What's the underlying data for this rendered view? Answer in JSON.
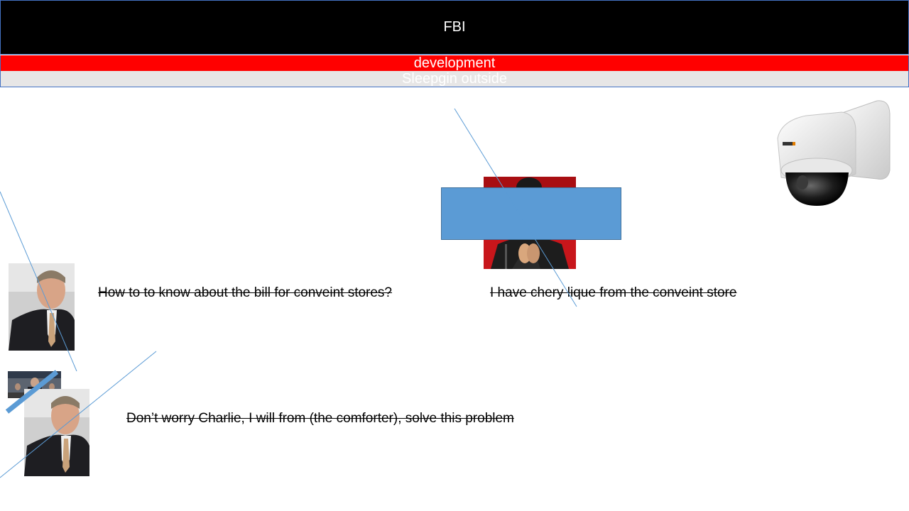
{
  "header": {
    "title": "FBI"
  },
  "subheader": {
    "label": "development"
  },
  "subheader2": {
    "label": "Sleepgin outside"
  },
  "captions": {
    "question": "How to to know about the bill for conveint stores?",
    "answer": "I have chery lique from the conveint store",
    "reply": "Don’t worry Charlie, I will from (the comforter), solve this problem"
  },
  "colors": {
    "title_bg": "#000000",
    "red_bar": "#ff0000",
    "grey_bar": "#e7e6e6",
    "shape_blue": "#5b9bd5",
    "line_blue": "#5b9bd5"
  },
  "icons": [
    "security-camera-icon",
    "person-photo",
    "group-photo"
  ]
}
